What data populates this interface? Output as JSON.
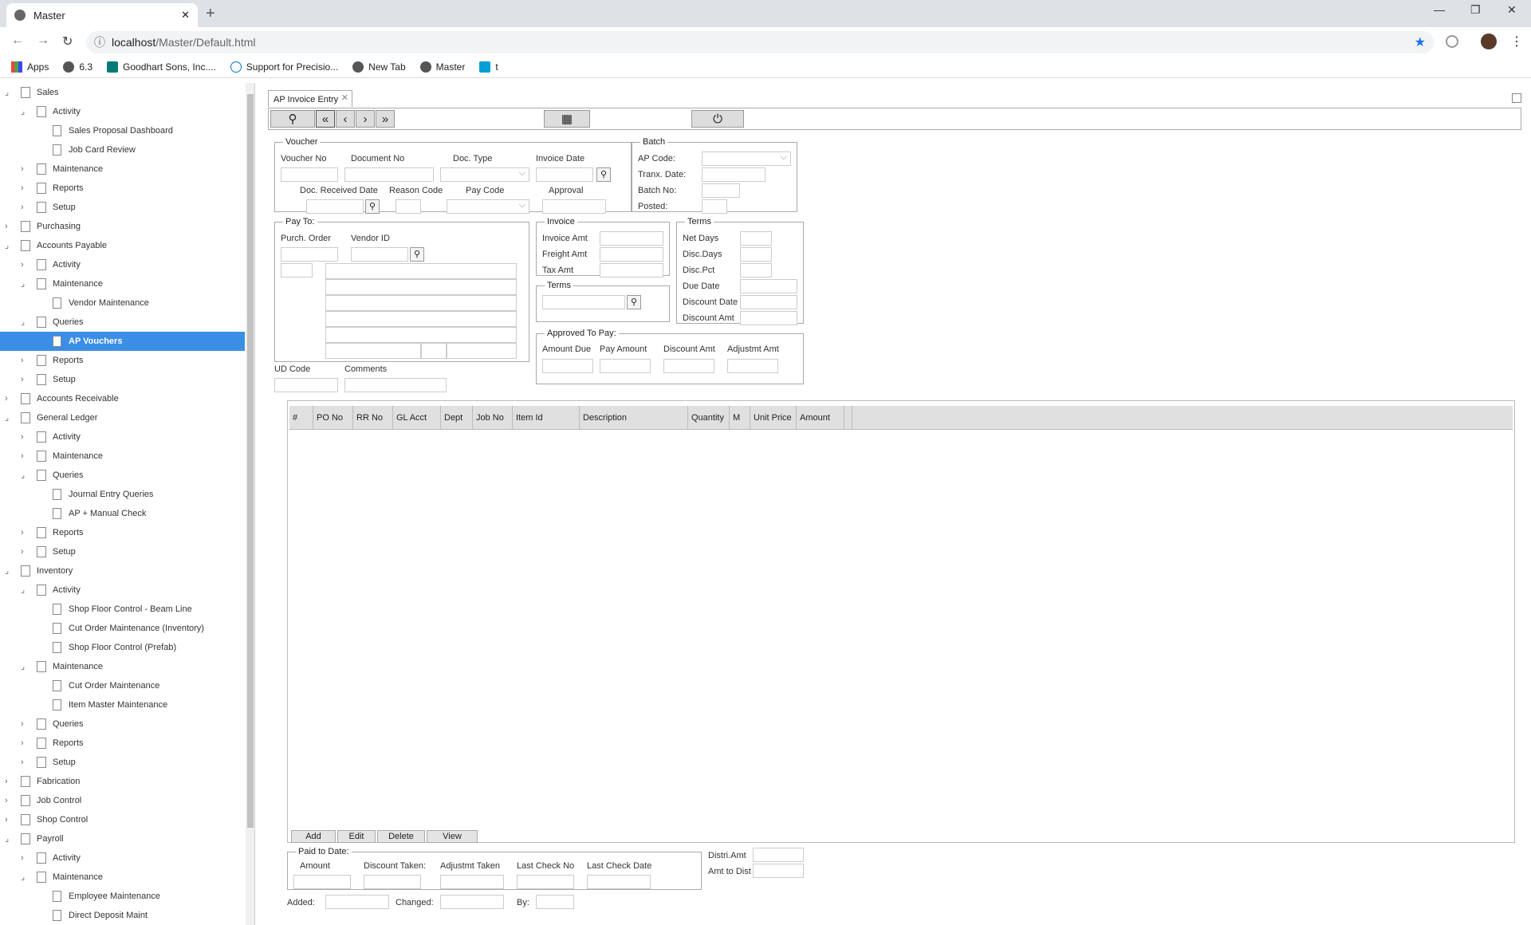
{
  "browser": {
    "tab_title": "Master",
    "url_host": "localhost",
    "url_path": "/Master/Default.html",
    "bookmarks": [
      "Apps",
      "6.3",
      "Goodhart Sons, Inc....",
      "Support for Precisio...",
      "New Tab",
      "Master",
      "t"
    ]
  },
  "tree": [
    {
      "label": "Sales",
      "level": 0,
      "state": "open",
      "kind": "folder"
    },
    {
      "label": "Activity",
      "level": 1,
      "state": "open",
      "kind": "folder"
    },
    {
      "label": "Sales Proposal Dashboard",
      "level": 2,
      "state": "leaf",
      "kind": "doc"
    },
    {
      "label": "Job Card Review",
      "level": 2,
      "state": "leaf",
      "kind": "doc"
    },
    {
      "label": "Maintenance",
      "level": 1,
      "state": "closed",
      "kind": "folder"
    },
    {
      "label": "Reports",
      "level": 1,
      "state": "closed",
      "kind": "folder"
    },
    {
      "label": "Setup",
      "level": 1,
      "state": "closed",
      "kind": "folder"
    },
    {
      "label": "Purchasing",
      "level": 0,
      "state": "closed",
      "kind": "folder"
    },
    {
      "label": "Accounts Payable",
      "level": 0,
      "state": "open",
      "kind": "folder"
    },
    {
      "label": "Activity",
      "level": 1,
      "state": "closed",
      "kind": "folder"
    },
    {
      "label": "Maintenance",
      "level": 1,
      "state": "open",
      "kind": "folder"
    },
    {
      "label": "Vendor Maintenance",
      "level": 2,
      "state": "leaf",
      "kind": "doc"
    },
    {
      "label": "Queries",
      "level": 1,
      "state": "open",
      "kind": "folder"
    },
    {
      "label": "AP Vouchers",
      "level": 2,
      "state": "leaf",
      "kind": "doc",
      "selected": true
    },
    {
      "label": "Reports",
      "level": 1,
      "state": "closed",
      "kind": "folder"
    },
    {
      "label": "Setup",
      "level": 1,
      "state": "closed",
      "kind": "folder"
    },
    {
      "label": "Accounts Receivable",
      "level": 0,
      "state": "closed",
      "kind": "folder"
    },
    {
      "label": "General Ledger",
      "level": 0,
      "state": "open",
      "kind": "folder"
    },
    {
      "label": "Activity",
      "level": 1,
      "state": "closed",
      "kind": "folder"
    },
    {
      "label": "Maintenance",
      "level": 1,
      "state": "closed",
      "kind": "folder"
    },
    {
      "label": "Queries",
      "level": 1,
      "state": "open",
      "kind": "folder"
    },
    {
      "label": "Journal Entry Queries",
      "level": 2,
      "state": "leaf",
      "kind": "doc"
    },
    {
      "label": "AP + Manual Check",
      "level": 2,
      "state": "leaf",
      "kind": "doc"
    },
    {
      "label": "Reports",
      "level": 1,
      "state": "closed",
      "kind": "folder"
    },
    {
      "label": "Setup",
      "level": 1,
      "state": "closed",
      "kind": "folder"
    },
    {
      "label": "Inventory",
      "level": 0,
      "state": "open",
      "kind": "folder"
    },
    {
      "label": "Activity",
      "level": 1,
      "state": "open",
      "kind": "folder"
    },
    {
      "label": "Shop Floor Control - Beam Line",
      "level": 2,
      "state": "leaf",
      "kind": "doc"
    },
    {
      "label": "Cut Order Maintenance (Inventory)",
      "level": 2,
      "state": "leaf",
      "kind": "doc"
    },
    {
      "label": "Shop Floor Control (Prefab)",
      "level": 2,
      "state": "leaf",
      "kind": "doc"
    },
    {
      "label": "Maintenance",
      "level": 1,
      "state": "open",
      "kind": "folder"
    },
    {
      "label": "Cut Order Maintenance",
      "level": 2,
      "state": "leaf",
      "kind": "doc"
    },
    {
      "label": "Item Master Maintenance",
      "level": 2,
      "state": "leaf",
      "kind": "doc"
    },
    {
      "label": "Queries",
      "level": 1,
      "state": "closed",
      "kind": "folder"
    },
    {
      "label": "Reports",
      "level": 1,
      "state": "closed",
      "kind": "folder"
    },
    {
      "label": "Setup",
      "level": 1,
      "state": "closed",
      "kind": "folder"
    },
    {
      "label": "Fabrication",
      "level": 0,
      "state": "closed",
      "kind": "folder"
    },
    {
      "label": "Job Control",
      "level": 0,
      "state": "closed",
      "kind": "folder"
    },
    {
      "label": "Shop Control",
      "level": 0,
      "state": "closed",
      "kind": "folder"
    },
    {
      "label": "Payroll",
      "level": 0,
      "state": "open",
      "kind": "folder"
    },
    {
      "label": "Activity",
      "level": 1,
      "state": "closed",
      "kind": "folder"
    },
    {
      "label": "Maintenance",
      "level": 1,
      "state": "open",
      "kind": "folder"
    },
    {
      "label": "Employee Maintenance",
      "level": 2,
      "state": "leaf",
      "kind": "doc"
    },
    {
      "label": "Direct Deposit Maint",
      "level": 2,
      "state": "leaf",
      "kind": "doc"
    }
  ],
  "form": {
    "tab_title": "AP Invoice Entry",
    "voucher": {
      "legend": "Voucher",
      "voucher_no": "Voucher No",
      "document_no": "Document No",
      "doc_type": "Doc. Type",
      "invoice_date": "Invoice Date",
      "doc_received_date": "Doc. Received Date",
      "reason_code": "Reason Code",
      "pay_code": "Pay Code",
      "approval": "Approval"
    },
    "batch": {
      "legend": "Batch",
      "ap_code": "AP Code:",
      "tranx_date": "Tranx. Date:",
      "batch_no": "Batch No:",
      "posted": "Posted:"
    },
    "payto": {
      "legend": "Pay To:",
      "purch_order": "Purch. Order",
      "vendor_id": "Vendor ID"
    },
    "invoice": {
      "legend": "Invoice",
      "invoice_amt": "Invoice Amt",
      "freight_amt": "Freight Amt",
      "tax_amt": "Tax Amt"
    },
    "terms_small": {
      "legend": "Terms"
    },
    "terms": {
      "legend": "Terms",
      "net_days": "Net Days",
      "disc_days": "Disc.Days",
      "disc_pct": "Disc.Pct",
      "due_date": "Due Date",
      "discount_date": "Discount Date",
      "discount_amt": "Discount Amt"
    },
    "approved": {
      "legend": "Approved To Pay:",
      "amount_due": "Amount Due",
      "pay_amount": "Pay Amount",
      "discount_amt": "Discount Amt",
      "adjustmt_amt": "Adjustmt Amt"
    },
    "ud_code": "UD Code",
    "comments": "Comments",
    "grid_columns": [
      "#",
      "PO No",
      "RR No",
      "GL Acct",
      "Dept",
      "Job No",
      "Item Id",
      "Description",
      "Quantity",
      "M",
      "Unit Price",
      "Amount",
      ""
    ],
    "grid_buttons": {
      "add": "Add",
      "edit": "Edit",
      "delete": "Delete",
      "view": "View"
    },
    "paid": {
      "legend": "Paid to Date:",
      "amount": "Amount",
      "discount_taken": "Discount Taken:",
      "adjustmt_taken": "Adjustmt Taken",
      "last_check_no": "Last Check No",
      "last_check_date": "Last Check Date"
    },
    "distri_amt": "Distri.Amt",
    "amt_to_dist": "Amt to Dist",
    "added": "Added:",
    "changed": "Changed:",
    "by": "By:"
  }
}
